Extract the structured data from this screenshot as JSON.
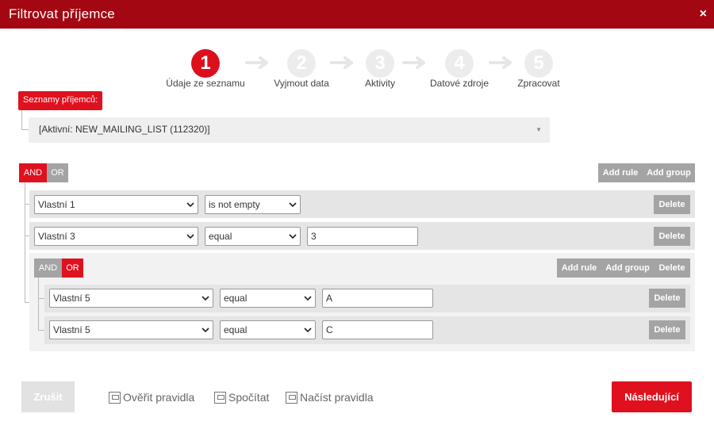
{
  "dialog": {
    "title": "Filtrovat příjemce",
    "close_label": "×"
  },
  "steps": [
    {
      "number": "1",
      "label": "Údaje ze seznamu",
      "active": true
    },
    {
      "number": "2",
      "label": "Vyjmout data",
      "active": false
    },
    {
      "number": "3",
      "label": "Aktivity",
      "active": false
    },
    {
      "number": "4",
      "label": "Datové zdroje",
      "active": false
    },
    {
      "number": "5",
      "label": "Zpracovat",
      "active": false
    }
  ],
  "recipients": {
    "label": "Seznamy příjemců:",
    "selected": "[Aktivní: NEW_MAILING_LIST (112320)]"
  },
  "root_group": {
    "and_label": "AND",
    "or_label": "OR",
    "add_rule": "Add rule",
    "add_group": "Add group",
    "rules": [
      {
        "field": "Vlastní 1",
        "operator": "is not empty",
        "value": "",
        "delete": "Delete"
      },
      {
        "field": "Vlastní 3",
        "operator": "equal",
        "value": "3",
        "delete": "Delete"
      }
    ]
  },
  "sub_group": {
    "and_label": "AND",
    "or_label": "OR",
    "add_rule": "Add rule",
    "add_group": "Add group",
    "delete": "Delete",
    "rules": [
      {
        "field": "Vlastní 5",
        "operator": "equal",
        "value": "A",
        "delete": "Delete"
      },
      {
        "field": "Vlastní 5",
        "operator": "equal",
        "value": "C",
        "delete": "Delete"
      }
    ]
  },
  "footer": {
    "cancel": "Zrušit",
    "verify": "Ověřit pravidla",
    "count": "Spočítat",
    "load": "Načíst pravidla",
    "next": "Následující"
  },
  "colors": {
    "title_bar": "#a30711",
    "accent_red": "#e0111f",
    "button_grey": "#a4a4a4"
  }
}
